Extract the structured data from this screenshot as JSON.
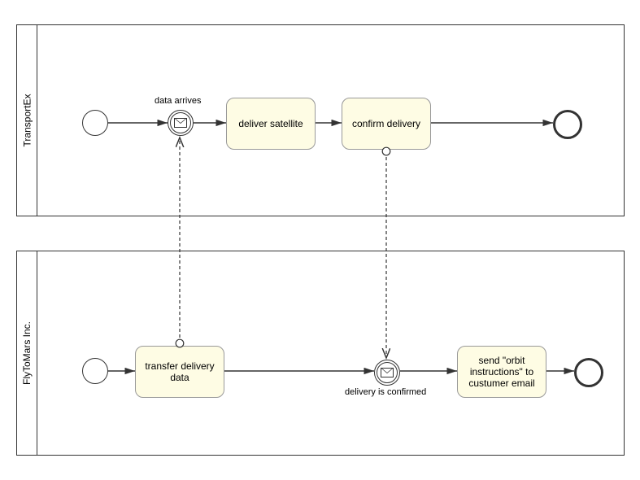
{
  "pools": {
    "top": {
      "label": "TransportEx"
    },
    "bottom": {
      "label": "FlyToMars Inc."
    }
  },
  "events": {
    "dataArrives": {
      "label": "data arrives"
    },
    "deliveryConfirmed": {
      "label": "delivery is confirmed"
    }
  },
  "tasks": {
    "deliverSatellite": "deliver satellite",
    "confirmDelivery": "confirm delivery",
    "transferDeliveryData": "transfer delivery data",
    "sendOrbitInstructions": "send \"orbit instructions\" to custumer email"
  }
}
